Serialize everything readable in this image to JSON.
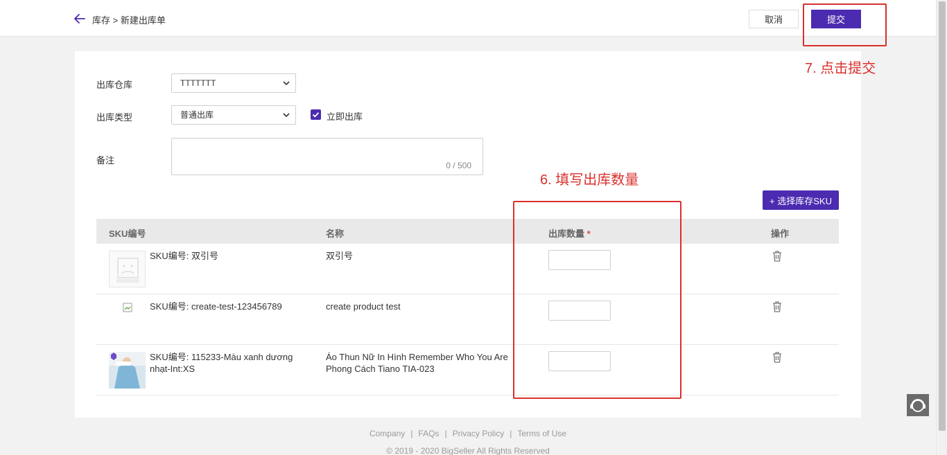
{
  "header": {
    "breadcrumb": "库存 > 新建出库单",
    "cancel_label": "取消",
    "submit_label": "提交"
  },
  "form": {
    "warehouse_label": "出库仓库",
    "warehouse_value": "TTTTTTT",
    "type_label": "出库类型",
    "type_value": "普通出库",
    "immediate_label": "立即出库",
    "immediate_checked": true,
    "remark_label": "备注",
    "remark_counter": "0 / 500"
  },
  "select_sku_button": "+ 选择库存SKU",
  "table": {
    "columns": [
      "SKU编号",
      "名称",
      "出库数量",
      "操作"
    ],
    "required_mark": "*",
    "rows": [
      {
        "sku": "SKU编号: 双引号",
        "name": "双引号",
        "quantity": ""
      },
      {
        "sku": "SKU编号: create-test-123456789",
        "name": "create product test",
        "quantity": ""
      },
      {
        "sku": "SKU编号: 115233-Màu xanh dương nhạt-Int:XS",
        "name": "Áo Thun Nữ In Hình Remember Who You Are Phong Cách Tiano TIA-023",
        "quantity": ""
      }
    ]
  },
  "annotations": {
    "step6": "6. 填写出库数量",
    "step7": "7. 点击提交"
  },
  "footer": {
    "links": [
      "Company",
      "FAQs",
      "Privacy Policy",
      "Terms of Use"
    ],
    "copyright": "© 2019 - 2020 BigSeller All Rights Reserved"
  },
  "colors": {
    "primary": "#4b2bb0",
    "annotation": "#d9302c"
  }
}
